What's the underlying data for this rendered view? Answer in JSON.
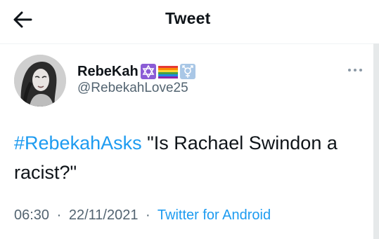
{
  "header": {
    "title": "Tweet",
    "back_icon": "arrow-left-icon"
  },
  "tweet": {
    "author": {
      "display_name": "RebeKah",
      "handle": "@RebekahLove25",
      "badges": [
        "star-of-david-icon",
        "rainbow-flag-icon",
        "transgender-symbol-icon"
      ]
    },
    "hashtag": "#RebekahAsks",
    "text": " \"Is Rachael Swindon a racist?\"",
    "time": "06:30",
    "separator": "·",
    "date": "22/11/2021",
    "source": "Twitter for Android",
    "more_icon": "more-horizontal-icon"
  },
  "colors": {
    "accent": "#1d9bf0",
    "secondary_text": "#536471",
    "primary_text": "#0f1419"
  }
}
